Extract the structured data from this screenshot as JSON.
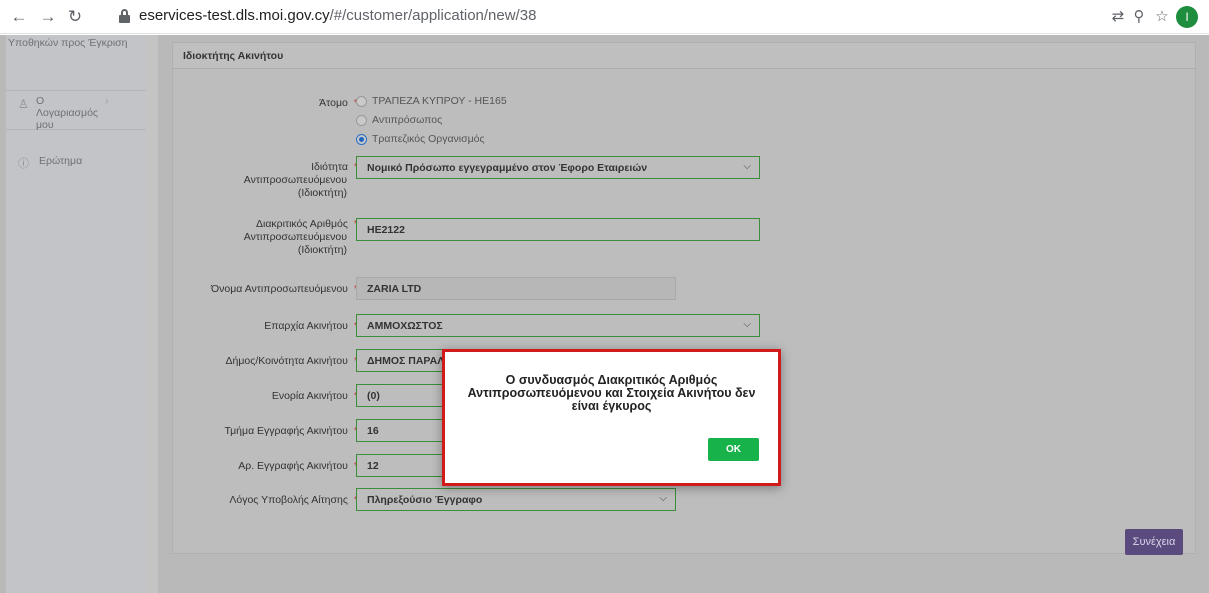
{
  "browser": {
    "url_host": "eservices-test.dls.moi.gov.cy",
    "url_path": "/#/customer/application/new/38",
    "profile_initial": "I"
  },
  "sidebar": {
    "top_item": "Υποθηκών προς Έγκριση",
    "account_label": "Ο Λογαριασμός μου",
    "question_label": "Ερώτημα"
  },
  "card": {
    "title": "Ιδιοκτήτης Ακινήτου"
  },
  "form": {
    "person_label": "Άτομο",
    "person_options": [
      "ΤΡΑΠΕΖΑ ΚΥΠΡΟΥ - HE165",
      "Αντιπρόσωπος",
      "Τραπεζικός Οργανισμός"
    ],
    "capacity_label_1": "Ιδιότητα",
    "capacity_label_2": "Αντιπροσωπευόμενου",
    "capacity_label_3": "(Ιδιοκτήτη)",
    "capacity_value": "Νομικό Πρόσωπο εγγεγραμμένο στον Έφορο Εταιρειών",
    "regno_label_1": "Διακριτικός Αριθμός",
    "regno_label_2": "Αντιπροσωπευόμενου",
    "regno_label_3": "(Ιδιοκτήτη)",
    "regno_value": "HE2122",
    "name_label": "Όνομα Αντιπροσωπευόμενου",
    "name_value": "ZARIA LTD",
    "district_label": "Επαρχία Ακινήτου",
    "district_value": "ΑΜΜΟΧΩΣΤΟΣ",
    "municipality_label": "Δήμος/Κοινότητα Ακινήτου",
    "municipality_value": "ΔΗΜΟΣ ΠΑΡΑΛ",
    "quarter_label": "Ενορία Ακινήτου",
    "quarter_value": "(0)",
    "section_label": "Τμήμα Εγγραφής Ακινήτου",
    "section_value": "16",
    "regnum_label": "Αρ. Εγγραφής Ακινήτου",
    "regnum_value": "12",
    "reason_label": "Λόγος Υποβολής Αίτησης",
    "reason_value": "Πληρεξούσιο Έγγραφο",
    "required_mark": "*"
  },
  "continue_button": "Συνέχεια",
  "modal": {
    "message": "Ο συνδυασμός Διακριτικός Αριθμός Αντιπροσωπευόμενου και Στοιχεία Ακινήτου δεν είναι έγκυρος",
    "ok_label": "OK"
  },
  "colors": {
    "modal_border": "#d11a1a",
    "ok_button": "#17b34a",
    "continue_button": "#5a4a7e",
    "field_border": "#3a8e3a"
  }
}
